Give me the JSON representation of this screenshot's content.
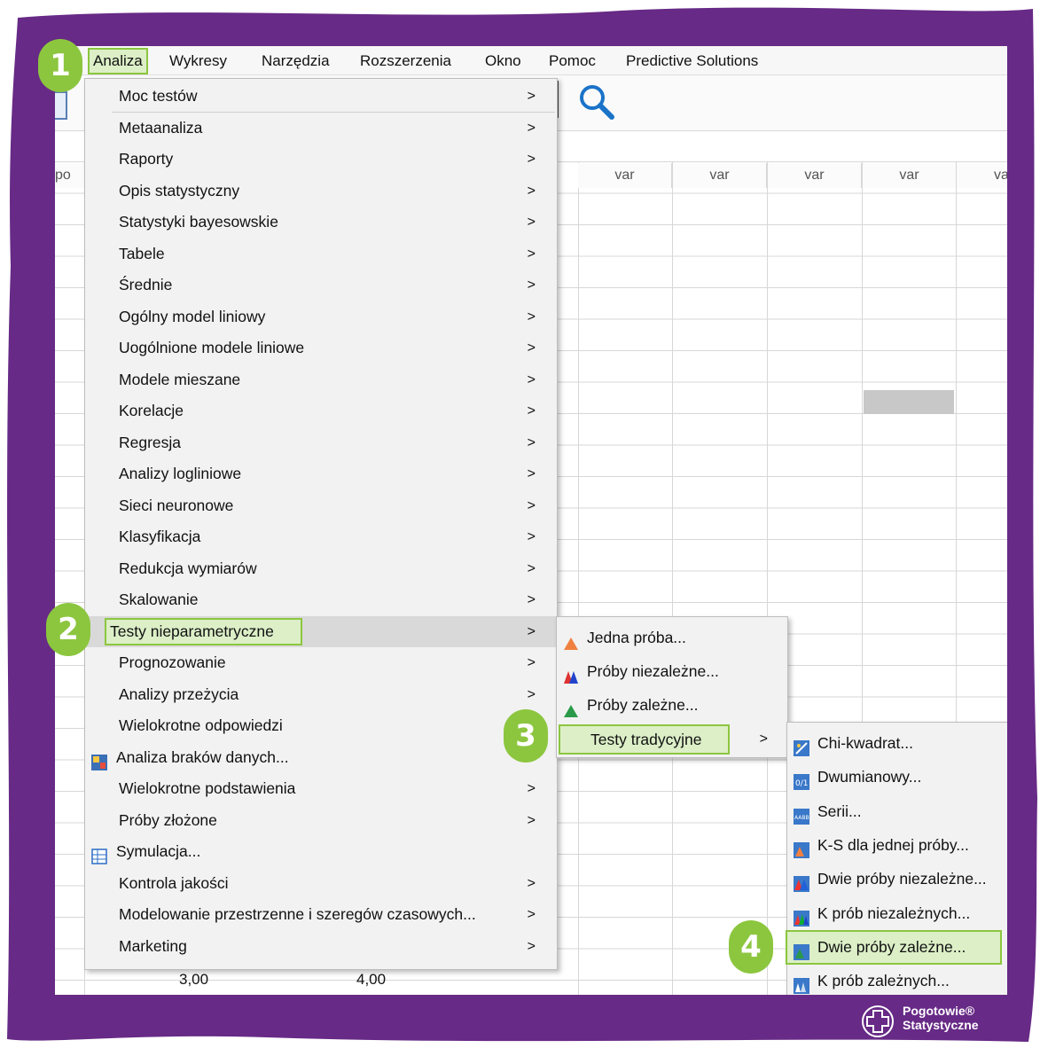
{
  "menubar": {
    "items": [
      "Analiza",
      "Wykresy",
      "Narzędzia",
      "Rozszerzenia",
      "Okno",
      "Pomoc",
      "Predictive Solutions"
    ]
  },
  "grid": {
    "left_header": "po",
    "col_header": "var",
    "cut_header": "va",
    "cell_values": [
      "3,00",
      "4,00"
    ]
  },
  "main_menu": {
    "items": [
      {
        "label": "Moc testów",
        "arrow": true
      },
      {
        "label": "Metaanaliza",
        "arrow": true
      },
      {
        "label": "Raporty",
        "arrow": true
      },
      {
        "label": "Opis statystyczny",
        "arrow": true
      },
      {
        "label": "Statystyki bayesowskie",
        "arrow": true
      },
      {
        "label": "Tabele",
        "arrow": true
      },
      {
        "label": "Średnie",
        "arrow": true
      },
      {
        "label": "Ogólny model liniowy",
        "arrow": true
      },
      {
        "label": "Uogólnione modele liniowe",
        "arrow": true
      },
      {
        "label": "Modele mieszane",
        "arrow": true
      },
      {
        "label": "Korelacje",
        "arrow": true
      },
      {
        "label": "Regresja",
        "arrow": true
      },
      {
        "label": "Analizy logliniowe",
        "arrow": true
      },
      {
        "label": "Sieci neuronowe",
        "arrow": true
      },
      {
        "label": "Klasyfikacja",
        "arrow": true
      },
      {
        "label": "Redukcja wymiarów",
        "arrow": true
      },
      {
        "label": "Skalowanie",
        "arrow": true
      },
      {
        "label": "Testy nieparametryczne",
        "arrow": true
      },
      {
        "label": "Prognozowanie",
        "arrow": true
      },
      {
        "label": "Analizy przeżycia",
        "arrow": true
      },
      {
        "label": "Wielokrotne odpowiedzi",
        "arrow": false
      },
      {
        "label": "Analiza braków danych...",
        "arrow": false
      },
      {
        "label": "Wielokrotne podstawienia",
        "arrow": true
      },
      {
        "label": "Próby złożone",
        "arrow": true
      },
      {
        "label": "Symulacja...",
        "arrow": false
      },
      {
        "label": "Kontrola jakości",
        "arrow": true
      },
      {
        "label": "Modelowanie przestrzenne i szeregów czasowych...",
        "arrow": true
      },
      {
        "label": "Marketing",
        "arrow": true
      }
    ]
  },
  "submenu1": {
    "items": [
      {
        "label": "Jedna próba...",
        "arrow": false
      },
      {
        "label": "Próby niezależne...",
        "arrow": false
      },
      {
        "label": "Próby zależne...",
        "arrow": false
      },
      {
        "label": "Testy tradycyjne",
        "arrow": true
      }
    ]
  },
  "submenu2": {
    "items": [
      {
        "label": "Chi-kwadrat..."
      },
      {
        "label": "Dwumianowy..."
      },
      {
        "label": "Serii..."
      },
      {
        "label": "K-S dla jednej próby..."
      },
      {
        "label": "Dwie próby niezależne..."
      },
      {
        "label": "K prób niezależnych..."
      },
      {
        "label": "Dwie próby zależne..."
      },
      {
        "label": "K prób zależnych..."
      }
    ]
  },
  "steps": [
    "1",
    "2",
    "3",
    "4"
  ],
  "brand": {
    "line1": "Pogotowie®",
    "line2": "Statystyczne"
  },
  "colors": {
    "frame": "#672a86",
    "accent": "#8cc63f",
    "highlight": "#d9d9d9"
  },
  "arrow_glyph": ">"
}
